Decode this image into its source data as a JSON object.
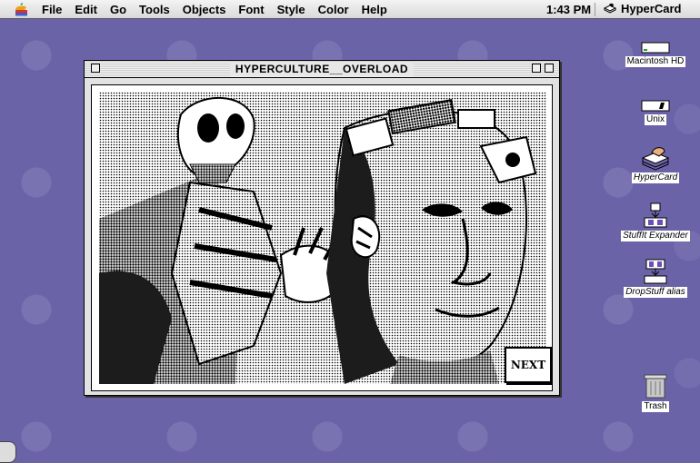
{
  "menubar": {
    "items": [
      "File",
      "Edit",
      "Go",
      "Tools",
      "Objects",
      "Font",
      "Style",
      "Color",
      "Help"
    ],
    "clock": "1:43 PM",
    "app_name": "HyperCard"
  },
  "window": {
    "title": "HYPERCULTURE__OVERLOAD",
    "next_label": "NEXT"
  },
  "desktop_icons": [
    {
      "label": "Macintosh HD",
      "icon": "hard-disk-icon"
    },
    {
      "label": "Unix",
      "icon": "disk-icon"
    },
    {
      "label": "HyperCard",
      "icon": "hypercard-app-icon"
    },
    {
      "label": "StuffIt Expander",
      "icon": "stuffit-icon"
    },
    {
      "label": "DropStuff alias",
      "icon": "dropstuff-icon"
    },
    {
      "label": "Trash",
      "icon": "trash-icon"
    }
  ],
  "colors": {
    "desktop": "#6b63a8",
    "menubar": "#e6e6e6"
  }
}
